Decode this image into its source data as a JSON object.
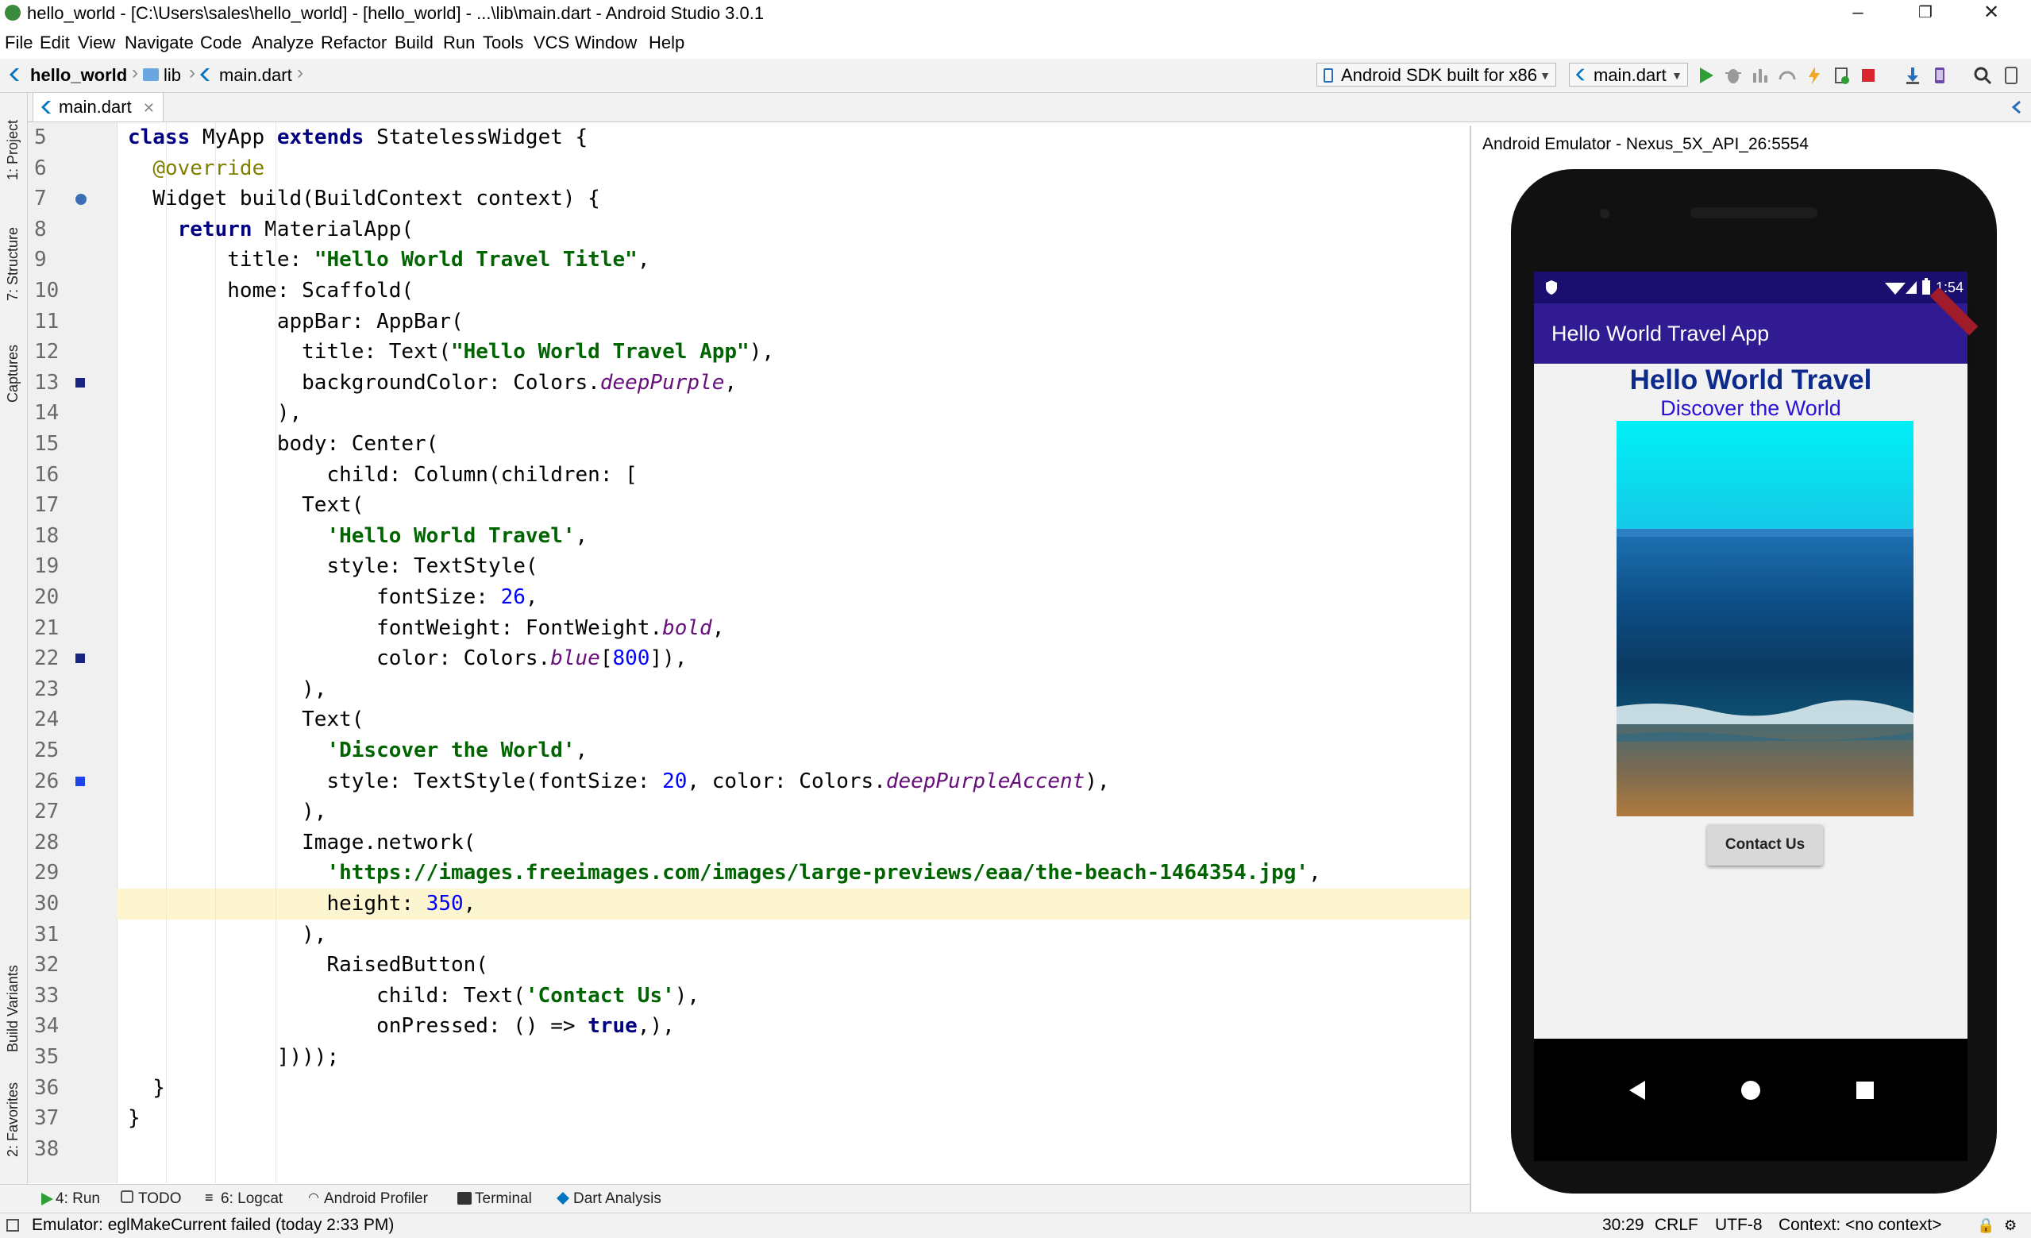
{
  "window": {
    "title": "hello_world - [C:\\Users\\sales\\hello_world] - [hello_world] - ...\\lib\\main.dart - Android Studio 3.0.1"
  },
  "menu": [
    "File",
    "Edit",
    "View",
    "Navigate",
    "Code",
    "Analyze",
    "Refactor",
    "Build",
    "Run",
    "Tools",
    "VCS",
    "Window",
    "Help"
  ],
  "breadcrumb": {
    "project": "hello_world",
    "folder": "lib",
    "file": "main.dart"
  },
  "toolbar": {
    "device_select": "Android SDK built for x86",
    "run_config": "main.dart"
  },
  "left_tabs": [
    "1: Project",
    "7: Structure",
    "Captures",
    "Build Variants",
    "2: Favorites"
  ],
  "editor_tab": "main.dart",
  "code_lines": [
    {
      "n": "5",
      "t": "class MyApp extends StatelessWidget {"
    },
    {
      "n": "6",
      "t": "  @override"
    },
    {
      "n": "7",
      "t": "  Widget build(BuildContext context) {"
    },
    {
      "n": "8",
      "t": "    return MaterialApp("
    },
    {
      "n": "9",
      "t": "        title: \"Hello World Travel Title\","
    },
    {
      "n": "10",
      "t": "        home: Scaffold("
    },
    {
      "n": "11",
      "t": "            appBar: AppBar("
    },
    {
      "n": "12",
      "t": "              title: Text(\"Hello World Travel App\"),"
    },
    {
      "n": "13",
      "t": "              backgroundColor: Colors.deepPurple,"
    },
    {
      "n": "14",
      "t": "            ),"
    },
    {
      "n": "15",
      "t": "            body: Center("
    },
    {
      "n": "16",
      "t": "                child: Column(children: ["
    },
    {
      "n": "17",
      "t": "              Text("
    },
    {
      "n": "18",
      "t": "                'Hello World Travel',"
    },
    {
      "n": "19",
      "t": "                style: TextStyle("
    },
    {
      "n": "20",
      "t": "                    fontSize: 26,"
    },
    {
      "n": "21",
      "t": "                    fontWeight: FontWeight.bold,"
    },
    {
      "n": "22",
      "t": "                    color: Colors.blue[800]),"
    },
    {
      "n": "23",
      "t": "              ),"
    },
    {
      "n": "24",
      "t": "              Text("
    },
    {
      "n": "25",
      "t": "                'Discover the World',"
    },
    {
      "n": "26",
      "t": "                style: TextStyle(fontSize: 20, color: Colors.deepPurpleAccent),"
    },
    {
      "n": "27",
      "t": "              ),"
    },
    {
      "n": "28",
      "t": "              Image.network("
    },
    {
      "n": "29",
      "t": "                'https://images.freeimages.com/images/large-previews/eaa/the-beach-1464354.jpg',"
    },
    {
      "n": "30",
      "t": "                height: 350,"
    },
    {
      "n": "31",
      "t": "              ),"
    },
    {
      "n": "32",
      "t": "                RaisedButton("
    },
    {
      "n": "33",
      "t": "                    child: Text('Contact Us'),"
    },
    {
      "n": "34",
      "t": "                    onPressed: () => true,),"
    },
    {
      "n": "35",
      "t": "            ])));"
    },
    {
      "n": "36",
      "t": "  }"
    },
    {
      "n": "37",
      "t": "}"
    },
    {
      "n": "38",
      "t": ""
    }
  ],
  "current_line": "30",
  "emulator": {
    "window_title": "Android Emulator - Nexus_5X_API_26:5554",
    "clock": "1:54",
    "appbar_title": "Hello World Travel App",
    "heading": "Hello World Travel",
    "subheading": "Discover the World",
    "button_label": "Contact Us",
    "colors": {
      "appbar": "#311b92",
      "heading": "#1565c0",
      "subheading": "#651fff"
    }
  },
  "tool_windows": [
    "4: Run",
    "TODO",
    "6: Logcat",
    "Android Profiler",
    "Terminal",
    "Dart Analysis"
  ],
  "status": {
    "message": "Emulator: eglMakeCurrent failed (today 2:33 PM)",
    "position": "30:29",
    "line_sep": "CRLF",
    "encoding": "UTF-8",
    "context": "Context: <no context>"
  }
}
